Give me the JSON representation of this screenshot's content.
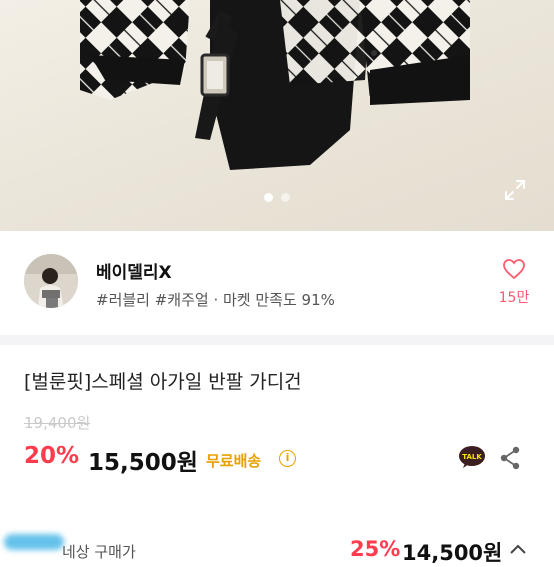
{
  "hero": {
    "page_dots": [
      true,
      false
    ],
    "expand_icon": "expand-icon"
  },
  "seller": {
    "name": "베이델리X",
    "meta": "#러블리 #캐주얼 · 마켓 만족도 91%",
    "like_icon": "heart-outline-icon",
    "like_count": "15만"
  },
  "product": {
    "title": "[벌룬핏]스페셜 아가일 반팔 가디건",
    "original_price": "19,400원",
    "discount": "20%",
    "price": "15,500원",
    "shipping": "무료배송",
    "info_icon": "i",
    "talk_label": "TALK"
  },
  "bottom": {
    "label": "네상 구매가",
    "discount": "25%",
    "price": "14,500원"
  },
  "colors": {
    "accent_red": "#ff3b4e",
    "shipping_yellow": "#e8a000",
    "kakao_yellow": "#f7e600"
  }
}
